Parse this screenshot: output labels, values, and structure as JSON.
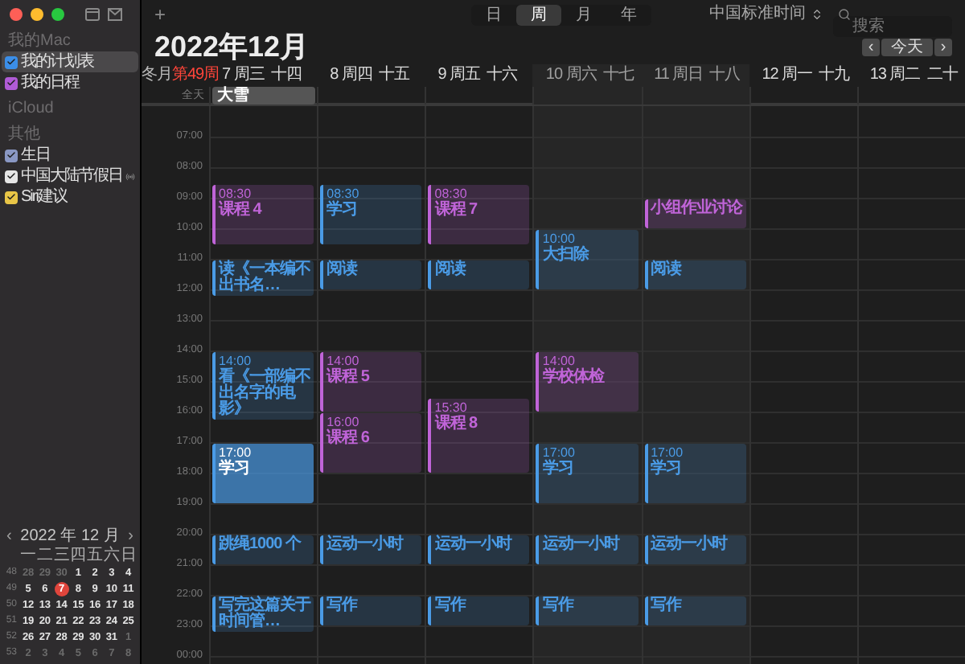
{
  "sidebar": {
    "sections": [
      {
        "title": "我的Mac",
        "items": [
          {
            "label": "我的计划表",
            "color": "#3b8ee8",
            "checked": true,
            "selected": true,
            "subscribed": false
          },
          {
            "label": "我的日程",
            "color": "#b05bd6",
            "checked": true,
            "selected": false,
            "subscribed": false
          }
        ]
      },
      {
        "title": "iCloud"
      },
      {
        "title": "其他",
        "items": [
          {
            "label": "生日",
            "color": "#8a98c4",
            "checked": true,
            "selected": false,
            "subscribed": false
          },
          {
            "label": "中国大陆节假日",
            "color": "#e6e6e6",
            "checked": true,
            "selected": false,
            "subscribed": true
          },
          {
            "label": "Siri建议",
            "color": "#e8c547",
            "checked": true,
            "selected": false,
            "subscribed": false
          }
        ]
      }
    ]
  },
  "mini_calendar": {
    "title": "2022 年 12 月",
    "prev": "‹",
    "next": "›",
    "weekdays": [
      "一",
      "二",
      "三",
      "四",
      "五",
      "六",
      "日"
    ],
    "weeks": [
      {
        "number": "48",
        "days": [
          {
            "label": "28",
            "in_month": false,
            "today": false
          },
          {
            "label": "29",
            "in_month": false,
            "today": false
          },
          {
            "label": "30",
            "in_month": false,
            "today": false
          },
          {
            "label": "1",
            "in_month": true,
            "today": false
          },
          {
            "label": "2",
            "in_month": true,
            "today": false
          },
          {
            "label": "3",
            "in_month": true,
            "today": false
          },
          {
            "label": "4",
            "in_month": true,
            "today": false
          }
        ]
      },
      {
        "number": "49",
        "days": [
          {
            "label": "5",
            "in_month": true,
            "today": false
          },
          {
            "label": "6",
            "in_month": true,
            "today": false
          },
          {
            "label": "7",
            "in_month": true,
            "today": true
          },
          {
            "label": "8",
            "in_month": true,
            "today": false
          },
          {
            "label": "9",
            "in_month": true,
            "today": false
          },
          {
            "label": "10",
            "in_month": true,
            "today": false
          },
          {
            "label": "11",
            "in_month": true,
            "today": false
          }
        ]
      },
      {
        "number": "50",
        "days": [
          {
            "label": "12",
            "in_month": true,
            "today": false
          },
          {
            "label": "13",
            "in_month": true,
            "today": false
          },
          {
            "label": "14",
            "in_month": true,
            "today": false
          },
          {
            "label": "15",
            "in_month": true,
            "today": false
          },
          {
            "label": "16",
            "in_month": true,
            "today": false
          },
          {
            "label": "17",
            "in_month": true,
            "today": false
          },
          {
            "label": "18",
            "in_month": true,
            "today": false
          }
        ]
      },
      {
        "number": "51",
        "days": [
          {
            "label": "19",
            "in_month": true,
            "today": false
          },
          {
            "label": "20",
            "in_month": true,
            "today": false
          },
          {
            "label": "21",
            "in_month": true,
            "today": false
          },
          {
            "label": "22",
            "in_month": true,
            "today": false
          },
          {
            "label": "23",
            "in_month": true,
            "today": false
          },
          {
            "label": "24",
            "in_month": true,
            "today": false
          },
          {
            "label": "25",
            "in_month": true,
            "today": false
          }
        ]
      },
      {
        "number": "52",
        "days": [
          {
            "label": "26",
            "in_month": true,
            "today": false
          },
          {
            "label": "27",
            "in_month": true,
            "today": false
          },
          {
            "label": "28",
            "in_month": true,
            "today": false
          },
          {
            "label": "29",
            "in_month": true,
            "today": false
          },
          {
            "label": "30",
            "in_month": true,
            "today": false
          },
          {
            "label": "31",
            "in_month": true,
            "today": false
          },
          {
            "label": "1",
            "in_month": false,
            "today": false
          }
        ]
      },
      {
        "number": "53",
        "days": [
          {
            "label": "2",
            "in_month": false,
            "today": false
          },
          {
            "label": "3",
            "in_month": false,
            "today": false
          },
          {
            "label": "4",
            "in_month": false,
            "today": false
          },
          {
            "label": "5",
            "in_month": false,
            "today": false
          },
          {
            "label": "6",
            "in_month": false,
            "today": false
          },
          {
            "label": "7",
            "in_month": false,
            "today": false
          },
          {
            "label": "8",
            "in_month": false,
            "today": false
          }
        ]
      }
    ]
  },
  "toolbar": {
    "add": "+",
    "views": [
      {
        "label": "日",
        "selected": false
      },
      {
        "label": "周",
        "selected": true
      },
      {
        "label": "月",
        "selected": false
      },
      {
        "label": "年",
        "selected": false
      }
    ],
    "timezone": "中国标准时间",
    "search": {
      "placeholder": "搜索"
    }
  },
  "title": "2022年12月",
  "nav": {
    "prev": "‹",
    "today": "今天",
    "next": "›"
  },
  "week_label": {
    "month": "冬月",
    "week": "第49周"
  },
  "all_day_label": "全天",
  "hours": [
    "07:00",
    "08:00",
    "09:00",
    "10:00",
    "11:00",
    "12:00",
    "13:00",
    "14:00",
    "15:00",
    "16:00",
    "17:00",
    "18:00",
    "19:00",
    "20:00",
    "21:00",
    "22:00",
    "23:00",
    "00:00"
  ],
  "days": [
    {
      "date": "7 周三",
      "lunar": "十四",
      "weekend": false,
      "all_day": [
        {
          "title": "大雪"
        }
      ],
      "events": [
        {
          "time": "08:30",
          "title": "课程 4",
          "color": "#c064d8",
          "selected": false
        },
        {
          "title": "读《一本编不出书名…",
          "color": "#4a9be6",
          "selected": false
        },
        {
          "time": "14:00",
          "title": "看《一部编不出名字的电影》",
          "color": "#4a9be6",
          "selected": false
        },
        {
          "time": "17:00",
          "title": "学习",
          "color": "#4a9be6",
          "selected": true
        },
        {
          "title": "跳绳1000 个",
          "color": "#4a9be6",
          "selected": false
        },
        {
          "title": "写完这篇关于时间管…",
          "color": "#4a9be6",
          "selected": false
        }
      ]
    },
    {
      "date": "8 周四",
      "lunar": "十五",
      "weekend": false,
      "events": [
        {
          "time": "08:30",
          "title": "学习",
          "color": "#4a9be6",
          "selected": false
        },
        {
          "title": "阅读",
          "color": "#4a9be6",
          "selected": false
        },
        {
          "time": "14:00",
          "title": "课程 5",
          "color": "#c064d8",
          "selected": false
        },
        {
          "time": "16:00",
          "title": "课程 6",
          "color": "#c064d8",
          "selected": false
        },
        {
          "title": "运动一小时",
          "color": "#4a9be6",
          "selected": false
        },
        {
          "title": "写作",
          "color": "#4a9be6",
          "selected": false
        }
      ]
    },
    {
      "date": "9 周五",
      "lunar": "十六",
      "weekend": false,
      "events": [
        {
          "time": "08:30",
          "title": "课程 7",
          "color": "#c064d8",
          "selected": false
        },
        {
          "title": "阅读",
          "color": "#4a9be6",
          "selected": false
        },
        {
          "time": "15:30",
          "title": "课程 8",
          "color": "#c064d8",
          "selected": false
        },
        {
          "title": "运动一小时",
          "color": "#4a9be6",
          "selected": false
        },
        {
          "title": "写作",
          "color": "#4a9be6",
          "selected": false
        }
      ]
    },
    {
      "date": "10 周六",
      "lunar": "十七",
      "weekend": true,
      "events": [
        {
          "time": "10:00",
          "title": "大扫除",
          "color": "#4a9be6",
          "selected": false
        },
        {
          "time": "14:00",
          "title": "学校体检",
          "color": "#c064d8",
          "selected": false
        },
        {
          "time": "17:00",
          "title": "学习",
          "color": "#4a9be6",
          "selected": false
        },
        {
          "title": "运动一小时",
          "color": "#4a9be6",
          "selected": false
        },
        {
          "title": "写作",
          "color": "#4a9be6",
          "selected": false
        }
      ]
    },
    {
      "date": "11 周日",
      "lunar": "十八",
      "weekend": true,
      "events": [
        {
          "title": "小组作业讨论",
          "color": "#c064d8",
          "selected": false
        },
        {
          "title": "阅读",
          "color": "#4a9be6",
          "selected": false
        },
        {
          "time": "17:00",
          "title": "学习",
          "color": "#4a9be6",
          "selected": false
        },
        {
          "title": "运动一小时",
          "color": "#4a9be6",
          "selected": false
        },
        {
          "title": "写作",
          "color": "#4a9be6",
          "selected": false
        }
      ]
    },
    {
      "date": "12 周一",
      "lunar": "十九",
      "weekend": false
    },
    {
      "date": "13 周二",
      "lunar": "二十",
      "weekend": false
    }
  ]
}
